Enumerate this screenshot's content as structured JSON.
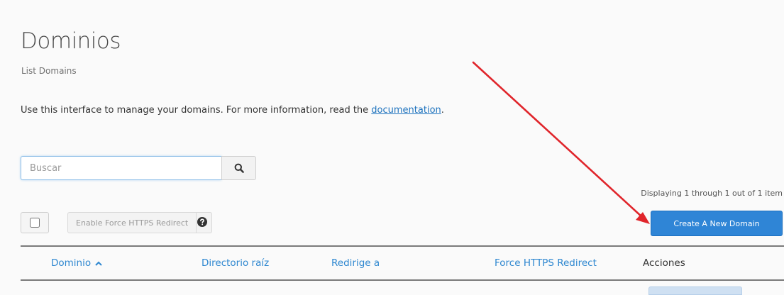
{
  "page": {
    "title": "Dominios",
    "subtitle": "List Domains",
    "intro_text": "Use this interface to manage your domains. For more information, read the ",
    "intro_link": "documentation",
    "intro_end": "."
  },
  "search": {
    "placeholder": "Buscar",
    "button_icon": "search-icon"
  },
  "pagination": {
    "text": "Displaying 1 through 1 out of 1 item"
  },
  "toolbar": {
    "force_https_label": "Enable Force HTTPS Redirect",
    "create_label": "Create A New Domain"
  },
  "table": {
    "columns": {
      "domain": "Dominio",
      "docroot": "Directorio raíz",
      "redirect": "Redirige a",
      "force_https": "Force HTTPS Redirect",
      "actions": "Acciones"
    }
  },
  "colors": {
    "accent": "#2f85d6",
    "link": "#1e73be",
    "annotation_arrow": "#e0252b"
  }
}
